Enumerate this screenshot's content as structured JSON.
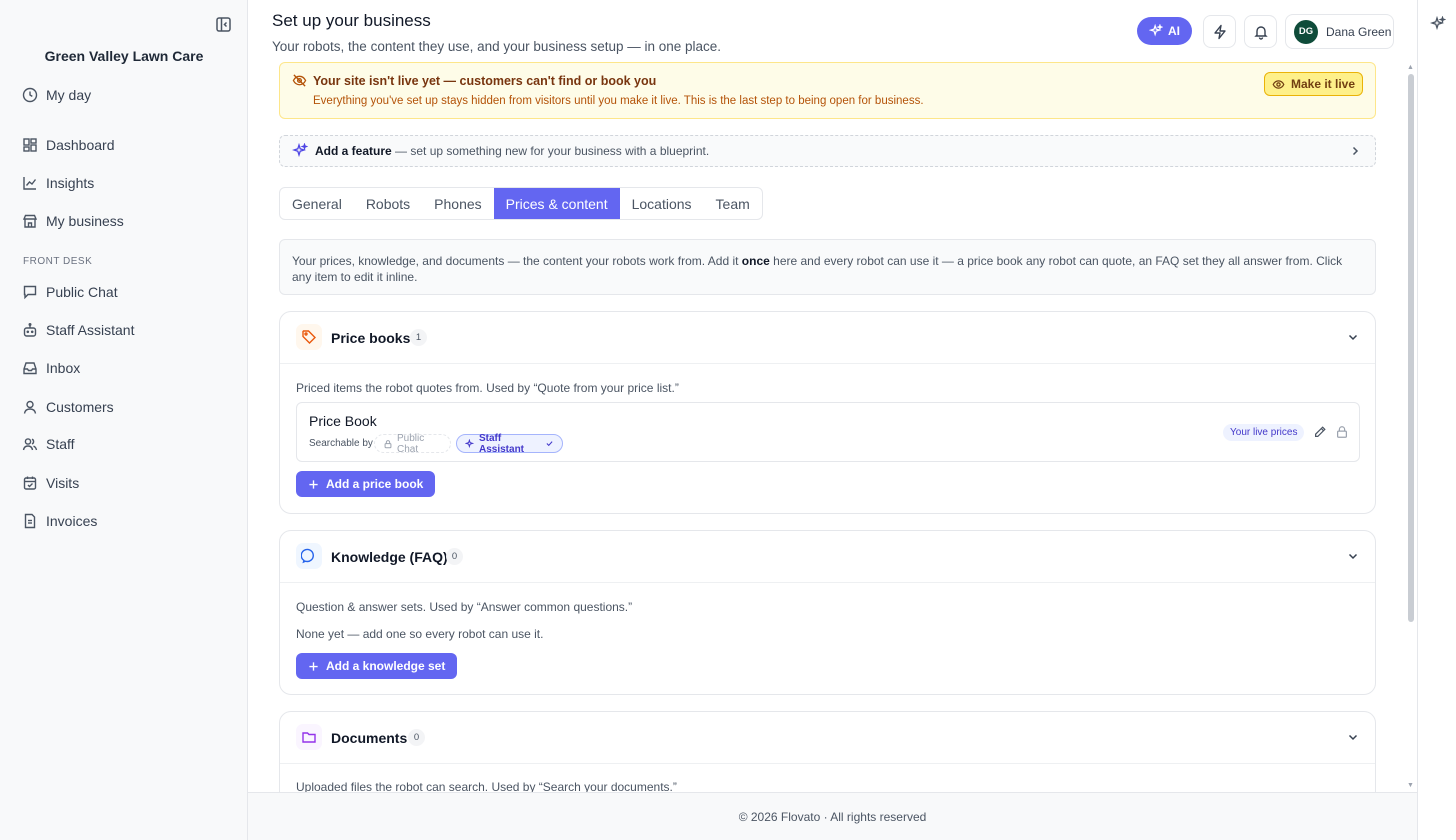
{
  "sidebar": {
    "business_name": "Green Valley Lawn Care",
    "top_items": [
      {
        "label": "My day",
        "icon": "clock-icon"
      }
    ],
    "main_items": [
      {
        "label": "Dashboard",
        "icon": "dashboard-icon"
      },
      {
        "label": "Insights",
        "icon": "line-chart-icon"
      },
      {
        "label": "My business",
        "icon": "store-icon"
      }
    ],
    "section_label": "FRONT DESK",
    "front_desk_items": [
      {
        "label": "Public Chat",
        "icon": "chat-icon"
      },
      {
        "label": "Staff Assistant",
        "icon": "bot-icon"
      },
      {
        "label": "Inbox",
        "icon": "inbox-icon"
      },
      {
        "label": "Customers",
        "icon": "user-icon"
      },
      {
        "label": "Staff",
        "icon": "users-icon"
      },
      {
        "label": "Visits",
        "icon": "calendar-icon"
      },
      {
        "label": "Invoices",
        "icon": "document-icon"
      }
    ]
  },
  "header": {
    "title": "Set up your business",
    "subtitle": "Your robots, the content they use, and your business setup — in one place.",
    "ai_label": "AI",
    "user_initials": "DG",
    "user_name": "Dana Green"
  },
  "banner": {
    "title": "Your site isn't live yet — customers can't find or book you",
    "description": "Everything you've set up stays hidden from visitors until you make it live. This is the last step to being open for business.",
    "button_label": "Make it live"
  },
  "feature": {
    "strong": "Add a feature",
    "rest": " — set up something new for your business with a blueprint."
  },
  "tabs": [
    {
      "label": "General",
      "active": false
    },
    {
      "label": "Robots",
      "active": false
    },
    {
      "label": "Phones",
      "active": false
    },
    {
      "label": "Prices & content",
      "active": true
    },
    {
      "label": "Locations",
      "active": false
    },
    {
      "label": "Team",
      "active": false
    }
  ],
  "intro": {
    "part1": "Your prices, knowledge, and documents — the content your robots work from. Add it ",
    "bold": "once",
    "part2": " here and every robot can use it — a price book any robot can quote, an FAQ set they all answer from. Click any item to edit it inline."
  },
  "price_books": {
    "title": "Price books",
    "count": "1",
    "description": "Priced items the robot quotes from. Used by “Quote from your price list.”",
    "item": {
      "name": "Price Book",
      "searchable_label": "Searchable by",
      "chip_off": "Public Chat",
      "chip_on": "Staff Assistant",
      "badge": "Your live prices"
    },
    "add_label": "Add a price book"
  },
  "knowledge": {
    "title": "Knowledge (FAQ)",
    "count": "0",
    "description": "Question & answer sets. Used by “Answer common questions.”",
    "empty": "None yet — add one so every robot can use it.",
    "add_label": "Add a knowledge set"
  },
  "documents": {
    "title": "Documents",
    "count": "0",
    "description": "Uploaded files the robot can search. Used by “Search your documents.”"
  },
  "footer": {
    "text": "© 2026 Flovato · All rights reserved"
  },
  "colors": {
    "accent": "#6366f1",
    "banner_bg": "#fefce8",
    "banner_button": "#fef08a"
  }
}
